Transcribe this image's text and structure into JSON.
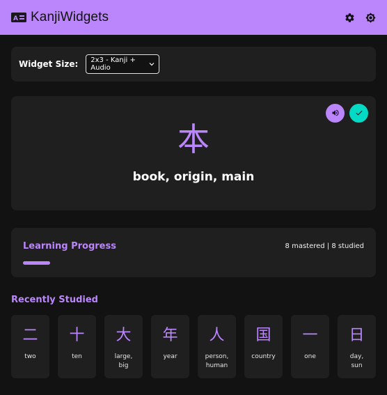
{
  "header": {
    "app_icon": "id-card-icon",
    "title": "KanjiWidgets",
    "actions": [
      {
        "icon": "gear-icon"
      },
      {
        "icon": "brightness-icon"
      }
    ]
  },
  "widget_size": {
    "label": "Widget Size:",
    "selected": "2x3 - Kanji + Audio"
  },
  "kanji_card": {
    "kanji": "本",
    "meaning": "book, origin, main",
    "audio_icon": "speaker-icon",
    "check_icon": "check-icon"
  },
  "progress": {
    "title": "Learning Progress",
    "stats": "8 mastered | 8 studied",
    "fill_fraction": 0.08
  },
  "recent": {
    "title": "Recently Studied",
    "items": [
      {
        "kanji": "二",
        "meaning": "two"
      },
      {
        "kanji": "十",
        "meaning": "ten"
      },
      {
        "kanji": "大",
        "meaning": "large,\nbig"
      },
      {
        "kanji": "年",
        "meaning": "year"
      },
      {
        "kanji": "人",
        "meaning": "person,\nhuman"
      },
      {
        "kanji": "国",
        "meaning": "country"
      },
      {
        "kanji": "一",
        "meaning": "one"
      },
      {
        "kanji": "日",
        "meaning": "day,\nsun"
      }
    ]
  },
  "colors": {
    "accent": "#bb86fc",
    "secondary": "#03dac6",
    "background": "#121212",
    "surface": "#1f1f1f"
  }
}
